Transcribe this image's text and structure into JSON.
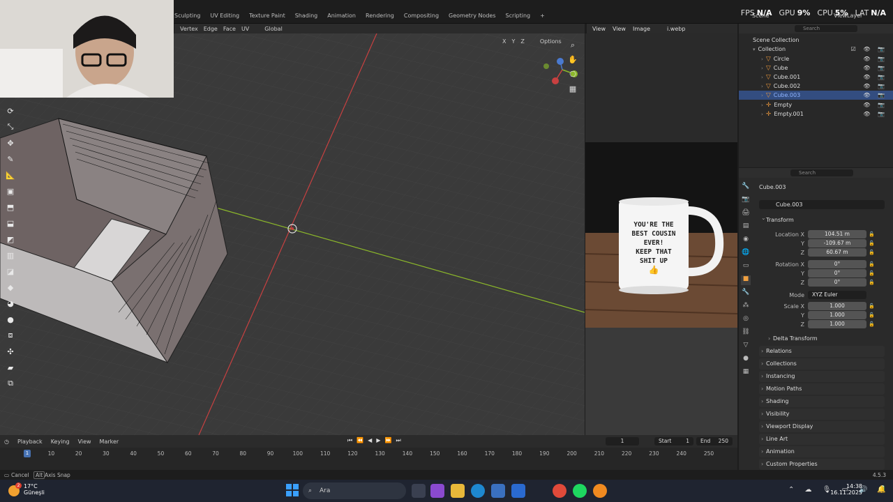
{
  "workspaces": [
    "Sculpting",
    "UV Editing",
    "Texture Paint",
    "Shading",
    "Animation",
    "Rendering",
    "Compositing",
    "Geometry Nodes",
    "Scripting",
    "+"
  ],
  "scene_label": "Scene",
  "view_layer_label": "ViewLayer",
  "stats": [
    {
      "label": "FPS",
      "value": "N/A"
    },
    {
      "label": "GPU",
      "value": "9%"
    },
    {
      "label": "CPU",
      "value": "5%"
    },
    {
      "label": "LAT",
      "value": "N/A"
    }
  ],
  "viewport_header": {
    "items": [
      "Vertex",
      "Edge",
      "Face",
      "UV"
    ],
    "orientation": "Global"
  },
  "options": {
    "axes": [
      "X",
      "Y",
      "Z"
    ],
    "options_label": "Options"
  },
  "image_editor": {
    "menu": [
      "View",
      "View",
      "Image"
    ],
    "image_name": "i.webp"
  },
  "mug_text": [
    "YOU'RE THE",
    "BEST COUSIN",
    "EVER!",
    "KEEP THAT",
    "SHIT UP"
  ],
  "outliner": {
    "search_placeholder": "Search",
    "scene_collection": "Scene Collection",
    "collection": "Collection",
    "objects": [
      {
        "name": "Circle",
        "selected": false
      },
      {
        "name": "Cube",
        "selected": false
      },
      {
        "name": "Cube.001",
        "selected": false
      },
      {
        "name": "Cube.002",
        "selected": false
      },
      {
        "name": "Cube.003",
        "selected": true
      },
      {
        "name": "Empty",
        "selected": false
      },
      {
        "name": "Empty.001",
        "selected": false
      }
    ]
  },
  "properties": {
    "search_placeholder": "Search",
    "object_title": "Cube.003",
    "object_name": "Cube.003",
    "transform_label": "Transform",
    "location_label": "Location X",
    "location": [
      "104.51 m",
      "-109.67 m",
      "60.67 m"
    ],
    "rotation_label": "Rotation X",
    "rotation": [
      "0°",
      "0°",
      "0°"
    ],
    "mode_label": "Mode",
    "mode_value": "XYZ Euler",
    "scale_label": "Scale X",
    "scale": [
      "1.000",
      "1.000",
      "1.000"
    ],
    "axis_y": "Y",
    "axis_z": "Z",
    "delta_transform": "Delta Transform",
    "panels": [
      "Relations",
      "Collections",
      "Instancing",
      "Motion Paths",
      "Shading",
      "Visibility",
      "Viewport Display",
      "Line Art",
      "Animation",
      "Custom Properties"
    ]
  },
  "timeline": {
    "menu": [
      "Playback",
      "Keying",
      "View",
      "Marker"
    ],
    "current_frame": "1",
    "start_label": "Start",
    "start": "1",
    "end_label": "End",
    "end": "250",
    "ticks": [
      "1",
      "10",
      "20",
      "30",
      "40",
      "50",
      "60",
      "70",
      "80",
      "90",
      "100",
      "110",
      "120",
      "130",
      "140",
      "150",
      "160",
      "170",
      "180",
      "190",
      "200",
      "210",
      "220",
      "230",
      "240",
      "250"
    ]
  },
  "statusbar": {
    "cancel": "Cancel",
    "alt": "Alt",
    "axis_snap": "Axis Snap",
    "version": "4.5.3"
  },
  "taskbar": {
    "weather_temp": "17°C",
    "weather_desc": "Güneşli",
    "badge": "2",
    "search_placeholder": "Ara",
    "time": "14:38",
    "date": "16.11.2025"
  },
  "colors": {
    "accent": "#4772b3",
    "x_axis": "#c84040",
    "y_axis": "#8cb82a",
    "selected_row": "#334d80",
    "object_orange": "#e8963c"
  }
}
